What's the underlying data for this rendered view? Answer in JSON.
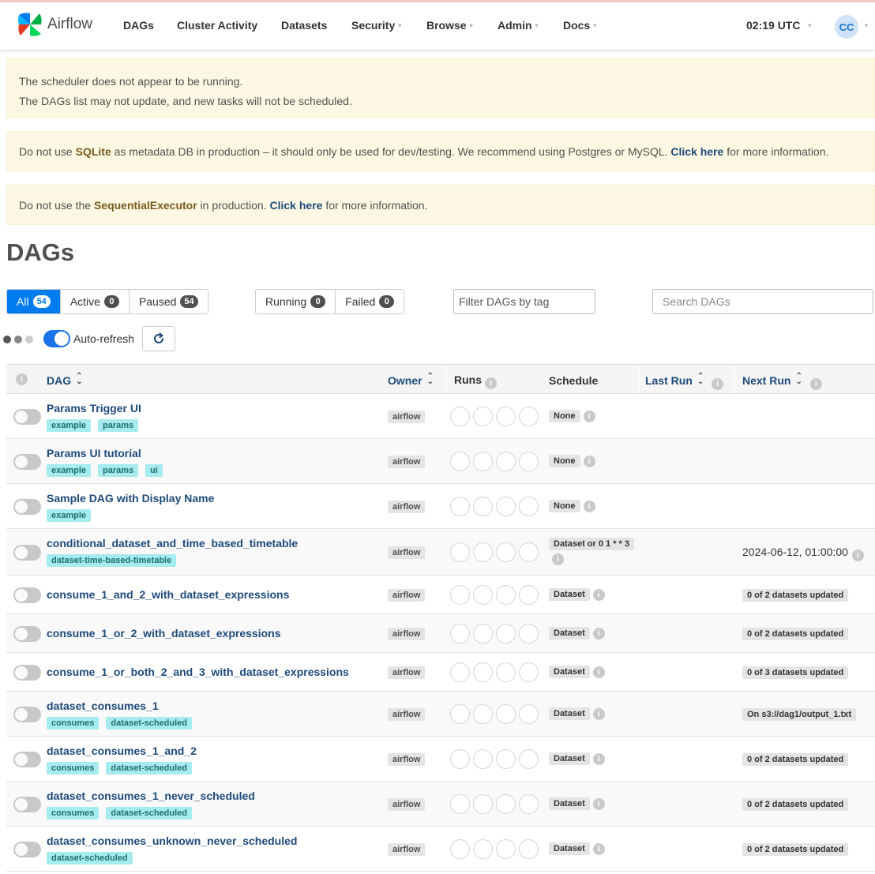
{
  "nav": {
    "brand": "Airflow",
    "items": [
      {
        "label": "DAGs",
        "caret": false
      },
      {
        "label": "Cluster Activity",
        "caret": false
      },
      {
        "label": "Datasets",
        "caret": false
      },
      {
        "label": "Security",
        "caret": true
      },
      {
        "label": "Browse",
        "caret": true
      },
      {
        "label": "Admin",
        "caret": true
      },
      {
        "label": "Docs",
        "caret": true
      }
    ],
    "time": "02:19 UTC",
    "user_initials": "CC"
  },
  "alerts": {
    "scheduler_line1": "The scheduler does not appear to be running.",
    "scheduler_line2": "The DAGs list may not update, and new tasks will not be scheduled.",
    "sqlite_pre": "Do not use ",
    "sqlite_strong": "SQLite",
    "sqlite_mid": " as metadata DB in production – it should only be used for dev/testing. We recommend using Postgres or MySQL. ",
    "sqlite_link": "Click here",
    "sqlite_post": " for more information.",
    "executor_pre": "Do not use the ",
    "executor_strong": "SequentialExecutor",
    "executor_mid": " in production. ",
    "executor_link": "Click here",
    "executor_post": " for more information."
  },
  "page_title": "DAGs",
  "status_filters": [
    {
      "label": "All",
      "count": "54"
    },
    {
      "label": "Active",
      "count": "0"
    },
    {
      "label": "Paused",
      "count": "54"
    }
  ],
  "run_filters": [
    {
      "label": "Running",
      "count": "0"
    },
    {
      "label": "Failed",
      "count": "0"
    }
  ],
  "tag_filter_placeholder": "Filter DAGs by tag",
  "search_placeholder": "Search DAGs",
  "auto_refresh_label": "Auto-refresh",
  "table": {
    "headers": {
      "dag": "DAG",
      "owner": "Owner",
      "runs": "Runs",
      "schedule": "Schedule",
      "last_run": "Last Run",
      "next_run": "Next Run"
    },
    "rows": [
      {
        "name": "Params Trigger UI",
        "tags": [
          "example",
          "params"
        ],
        "owner": "airflow",
        "schedule": "None",
        "next_run": "",
        "next_type": "none"
      },
      {
        "name": "Params UI tutorial",
        "tags": [
          "example",
          "params",
          "ui"
        ],
        "owner": "airflow",
        "schedule": "None",
        "next_run": "",
        "next_type": "none"
      },
      {
        "name": "Sample DAG with Display Name",
        "tags": [
          "example"
        ],
        "owner": "airflow",
        "schedule": "None",
        "next_run": "",
        "next_type": "none"
      },
      {
        "name": "conditional_dataset_and_time_based_timetable",
        "tags": [
          "dataset-time-based-timetable"
        ],
        "owner": "airflow",
        "schedule": "Dataset or 0 1 * * 3",
        "next_run": "2024-06-12, 01:00:00",
        "next_type": "date"
      },
      {
        "name": "consume_1_and_2_with_dataset_expressions",
        "tags": [],
        "owner": "airflow",
        "schedule": "Dataset",
        "next_run": "0 of 2 datasets updated",
        "next_type": "badge"
      },
      {
        "name": "consume_1_or_2_with_dataset_expressions",
        "tags": [],
        "owner": "airflow",
        "schedule": "Dataset",
        "next_run": "0 of 2 datasets updated",
        "next_type": "badge"
      },
      {
        "name": "consume_1_or_both_2_and_3_with_dataset_expressions",
        "tags": [],
        "owner": "airflow",
        "schedule": "Dataset",
        "next_run": "0 of 3 datasets updated",
        "next_type": "badge"
      },
      {
        "name": "dataset_consumes_1",
        "tags": [
          "consumes",
          "dataset-scheduled"
        ],
        "owner": "airflow",
        "schedule": "Dataset",
        "next_run": "On s3://dag1/output_1.txt",
        "next_type": "badge"
      },
      {
        "name": "dataset_consumes_1_and_2",
        "tags": [
          "consumes",
          "dataset-scheduled"
        ],
        "owner": "airflow",
        "schedule": "Dataset",
        "next_run": "0 of 2 datasets updated",
        "next_type": "badge"
      },
      {
        "name": "dataset_consumes_1_never_scheduled",
        "tags": [
          "consumes",
          "dataset-scheduled"
        ],
        "owner": "airflow",
        "schedule": "Dataset",
        "next_run": "0 of 2 datasets updated",
        "next_type": "badge"
      },
      {
        "name": "dataset_consumes_unknown_never_scheduled",
        "tags": [
          "dataset-scheduled"
        ],
        "owner": "airflow",
        "schedule": "Dataset",
        "next_run": "0 of 2 datasets updated",
        "next_type": "badge"
      }
    ]
  },
  "colors": {
    "primary": "#017cee",
    "link": "#1d4a7a",
    "alert_bg": "#fcf8e3",
    "tag_bg": "#a6ecee"
  }
}
